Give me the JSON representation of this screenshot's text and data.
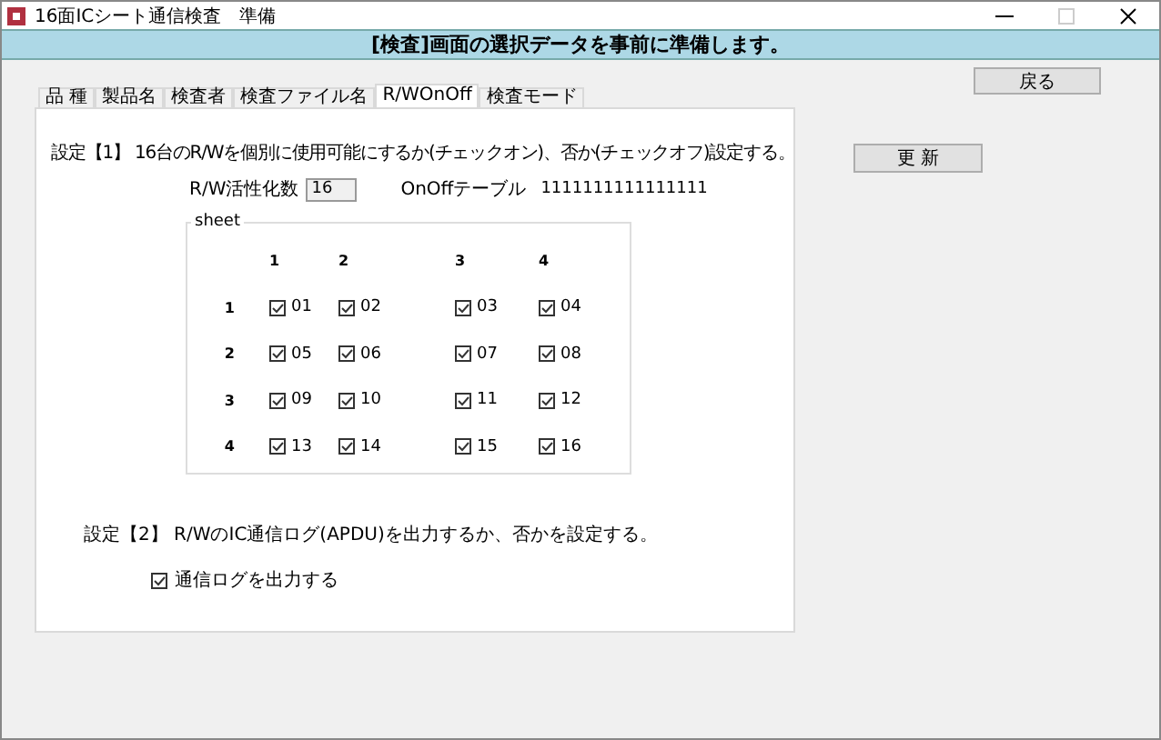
{
  "window": {
    "title": "16面ICシート通信検査　準備"
  },
  "banner": "[検査]画面の選択データを事前に準備します。",
  "back_button": "戻る",
  "update_button": "更 新",
  "tabs": [
    {
      "label": "品 種",
      "selected": false
    },
    {
      "label": "製品名",
      "selected": false
    },
    {
      "label": "検査者",
      "selected": false
    },
    {
      "label": "検査ファイル名",
      "selected": false
    },
    {
      "label": "R/WOnOff",
      "selected": true
    },
    {
      "label": "検査モード",
      "selected": false
    }
  ],
  "setting1": "設定【1】 16台のR/Wを個別に使用可能にするか(チェックオン)、否か(チェックオフ)設定する。",
  "rw_count": {
    "label": "R/W活性化数",
    "value": "16"
  },
  "onoff_table": {
    "label": "OnOffテーブル",
    "value": "1111111111111111"
  },
  "sheet": {
    "legend": "sheet",
    "column_headers": [
      "1",
      "2",
      "3",
      "4"
    ],
    "rows": [
      {
        "label": "1",
        "cells": [
          {
            "label": "01",
            "checked": true
          },
          {
            "label": "02",
            "checked": true
          },
          {
            "label": "03",
            "checked": true
          },
          {
            "label": "04",
            "checked": true
          }
        ]
      },
      {
        "label": "2",
        "cells": [
          {
            "label": "05",
            "checked": true
          },
          {
            "label": "06",
            "checked": true
          },
          {
            "label": "07",
            "checked": true
          },
          {
            "label": "08",
            "checked": true
          }
        ]
      },
      {
        "label": "3",
        "cells": [
          {
            "label": "09",
            "checked": true
          },
          {
            "label": "10",
            "checked": true
          },
          {
            "label": "11",
            "checked": true
          },
          {
            "label": "12",
            "checked": true
          }
        ]
      },
      {
        "label": "4",
        "cells": [
          {
            "label": "13",
            "checked": true
          },
          {
            "label": "14",
            "checked": true
          },
          {
            "label": "15",
            "checked": true
          },
          {
            "label": "16",
            "checked": true
          }
        ]
      }
    ]
  },
  "setting2": "設定【2】 R/WのIC通信ログ(APDU)を出力するか、否かを設定する。",
  "log_checkbox": {
    "label": "通信ログを出力する",
    "checked": true
  }
}
